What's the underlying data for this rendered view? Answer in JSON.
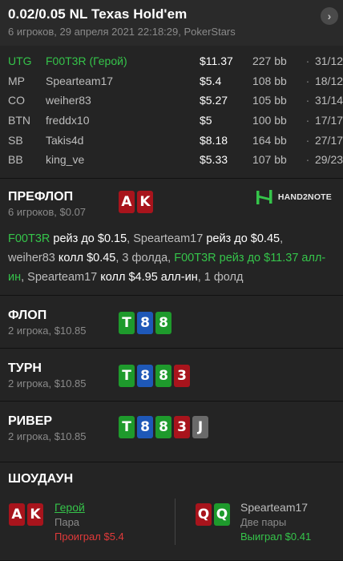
{
  "header": {
    "title": "0.02/0.05 NL Texas Hold'em",
    "subtitle": "6 игроков, 29 апреля 2021 22:18:29, PokerStars"
  },
  "players": [
    {
      "pos": "UTG",
      "name": "F00T3R (Герой)",
      "stack": "$11.37",
      "bb": "227 bb",
      "sep": "·",
      "ratio": "31/12",
      "hero": true
    },
    {
      "pos": "MP",
      "name": "Spearteam17",
      "stack": "$5.4",
      "bb": "108 bb",
      "sep": "·",
      "ratio": "18/12",
      "hero": false
    },
    {
      "pos": "CO",
      "name": "weiher83",
      "stack": "$5.27",
      "bb": "105 bb",
      "sep": "·",
      "ratio": "31/14",
      "hero": false
    },
    {
      "pos": "BTN",
      "name": "freddx10",
      "stack": "$5",
      "bb": "100 bb",
      "sep": "·",
      "ratio": "17/17",
      "hero": false
    },
    {
      "pos": "SB",
      "name": "Takis4d",
      "stack": "$8.18",
      "bb": "164 bb",
      "sep": "·",
      "ratio": "27/17",
      "hero": false
    },
    {
      "pos": "BB",
      "name": "king_ve",
      "stack": "$5.33",
      "bb": "107 bb",
      "sep": "·",
      "ratio": "29/23",
      "hero": false
    }
  ],
  "preflop": {
    "title": "ПРЕФЛОП",
    "sub": "6 игроков, $0.07",
    "cards": [
      "A",
      "K"
    ],
    "logo_text": "HAND2NOTE",
    "actions": {
      "p1": "F00T3R",
      "a1": "рейз до $0.15",
      "s1": ", ",
      "p2": "Spearteam17",
      "a2": "рейз до $0.45",
      "s2": ",",
      "p3": "weiher83",
      "a3": "колл $0.45",
      "s3": ", 3 фолда, ",
      "p4": "F00T3R",
      "a4": "рейз до $11.37 алл-ин",
      "s4": ", ",
      "p5": "Spearteam17",
      "a5": "колл $4.95 алл-ин",
      "s5": ", 1 фолд"
    }
  },
  "streets": [
    {
      "title": "ФЛОП",
      "sub": "2 игрока, $10.85",
      "cards": [
        "T",
        "8",
        "8"
      ]
    },
    {
      "title": "ТУРН",
      "sub": "2 игрока, $10.85",
      "cards": [
        "T",
        "8",
        "8",
        "3"
      ]
    },
    {
      "title": "РИВЕР",
      "sub": "2 игрока, $10.85",
      "cards": [
        "T",
        "8",
        "8",
        "3",
        "J"
      ]
    }
  ],
  "showdown": {
    "title": "ШОУДАУН",
    "hero": {
      "cards": [
        "A",
        "K"
      ],
      "name": "Герой",
      "hand": "Пара",
      "result": "Проиграл $5.4"
    },
    "villain": {
      "cards": [
        "Q",
        "Q"
      ],
      "name": "Spearteam17",
      "hand": "Две пары",
      "result": "Выиграл $0.41"
    }
  },
  "colors": {
    "hero_green": "#35c44a",
    "card_red": "#a8141c",
    "card_green": "#1e9a2c",
    "card_blue": "#1e58b8",
    "card_gray": "#6a6a6a",
    "loss_red": "#e03a3a"
  }
}
